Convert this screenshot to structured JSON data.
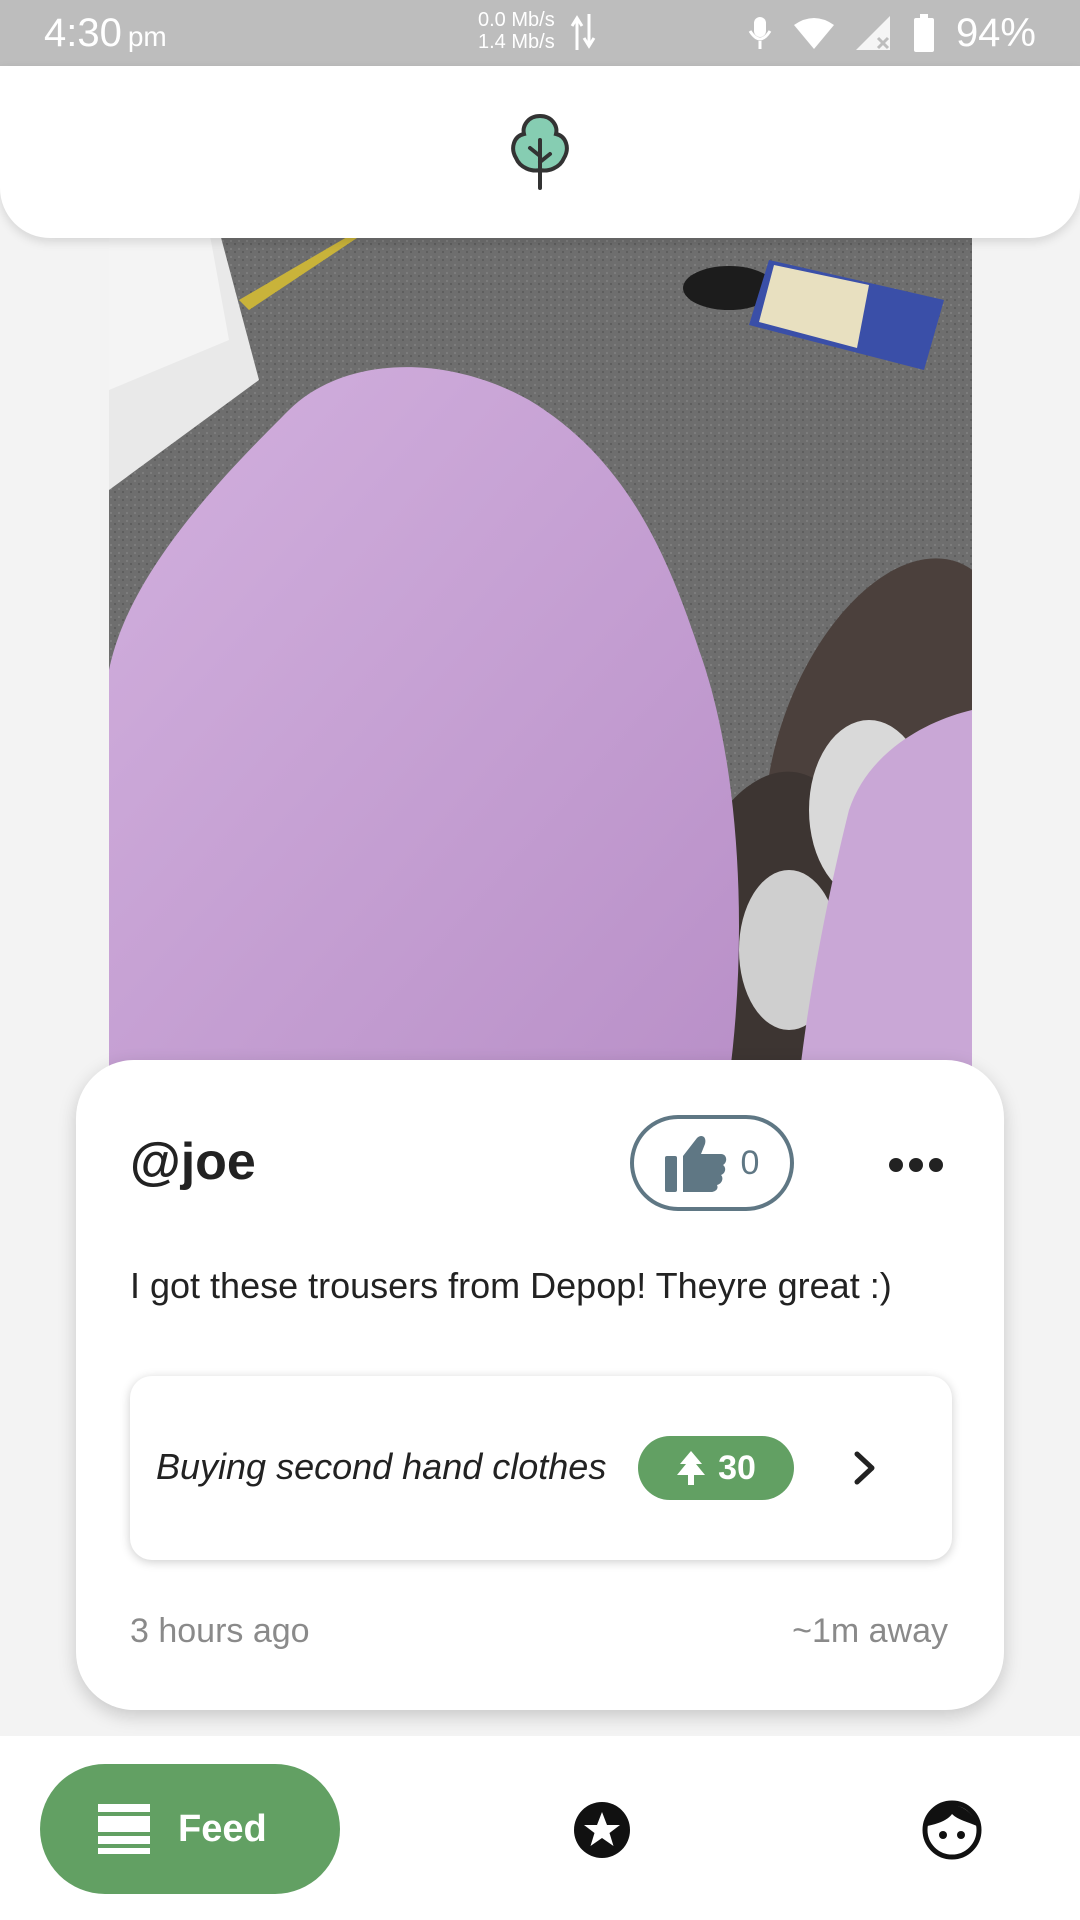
{
  "status_bar": {
    "time": "4:30",
    "period": "pm",
    "net_up": "0.0 Mb/s",
    "net_down": "1.4 Mb/s",
    "battery": "94%",
    "icons": [
      "microphone-icon",
      "wifi-icon",
      "signal-icon",
      "battery-icon"
    ]
  },
  "header": {
    "logo_icon": "tree-icon"
  },
  "post": {
    "username": "@joe",
    "likes": "0",
    "text": "I got these trousers from Depop! Theyre great :)",
    "activity": {
      "title": "Buying second hand clothes",
      "points": "30"
    },
    "time_ago": "3 hours ago",
    "distance": "~1m away"
  },
  "nav": {
    "feed_label": "Feed",
    "icons": [
      "feed-icon",
      "star-icon",
      "profile-icon"
    ]
  },
  "colors": {
    "accent_green": "#62a063",
    "like_outline": "#5f7784",
    "status_bar": "#bdbdbd",
    "trousers": "#c9a7d6",
    "carpet": "#6e6e6e"
  }
}
